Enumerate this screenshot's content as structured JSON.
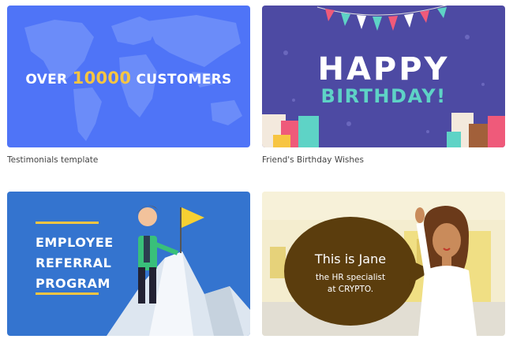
{
  "cards": [
    {
      "caption": "Testimonials template",
      "headline_prefix": "OVER",
      "headline_number": "10000",
      "headline_suffix": "CUSTOMERS",
      "bg": "#4f74f7",
      "accent": "#f7c542"
    },
    {
      "caption": "Friend's Birthday Wishes",
      "line1": "HAPPY",
      "line2": "BIRTHDAY!",
      "bg": "#4d4aa3",
      "accent": "#5ed3c6"
    },
    {
      "line1": "EMPLOYEE",
      "line2": "REFERRAL",
      "line3": "PROGRAM",
      "bg": "#3474cf",
      "accent": "#f7c542"
    },
    {
      "bubble_title": "This is Jane",
      "bubble_line1": "the HR specialist",
      "bubble_line2": "at CRYPTO.",
      "bg": "#f4edcf",
      "bubble_color": "#5b3d0d"
    }
  ],
  "icons": [
    "world-map-graphic",
    "bunting-flags",
    "gift-boxes",
    "businessman-illustration",
    "mountain-flag",
    "woman-waving-illustration"
  ]
}
